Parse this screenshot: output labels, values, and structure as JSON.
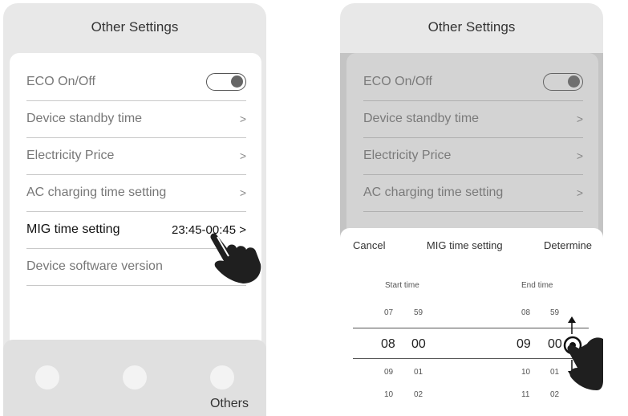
{
  "screens": [
    {
      "title": "Other Settings",
      "rows": [
        {
          "label": "ECO On/Off",
          "type": "toggle"
        },
        {
          "label": "Device standby time",
          "chevron": ">"
        },
        {
          "label": "Electricity Price",
          "chevron": ">"
        },
        {
          "label": "AC charging time setting",
          "chevron": ">"
        },
        {
          "label": "MIG time setting",
          "value": "23:45-00:45 >"
        },
        {
          "label": "Device software version"
        }
      ],
      "tabbar": {
        "active_tab_label": "Others"
      }
    },
    {
      "title": "Other Settings",
      "rows": [
        {
          "label": "ECO On/Off",
          "type": "toggle"
        },
        {
          "label": "Device standby time",
          "chevron": ">"
        },
        {
          "label": "Electricity Price",
          "chevron": ">"
        },
        {
          "label": "AC charging time setting",
          "chevron": ">"
        }
      ],
      "picker": {
        "cancel": "Cancel",
        "title": "MIG time setting",
        "confirm": "Determine",
        "start_label": "Start time",
        "end_label": "End time",
        "start_hours": [
          "07",
          "08",
          "09",
          "10"
        ],
        "start_minutes": [
          "59",
          "00",
          "01",
          "02"
        ],
        "end_hours": [
          "08",
          "09",
          "10",
          "11"
        ],
        "end_minutes": [
          "59",
          "00",
          "01",
          "02"
        ]
      }
    }
  ],
  "colors": {
    "background": "#ffffff",
    "screen_bg": "#e8e8e8",
    "card": "#ffffff",
    "divider": "#c8c8c8"
  }
}
